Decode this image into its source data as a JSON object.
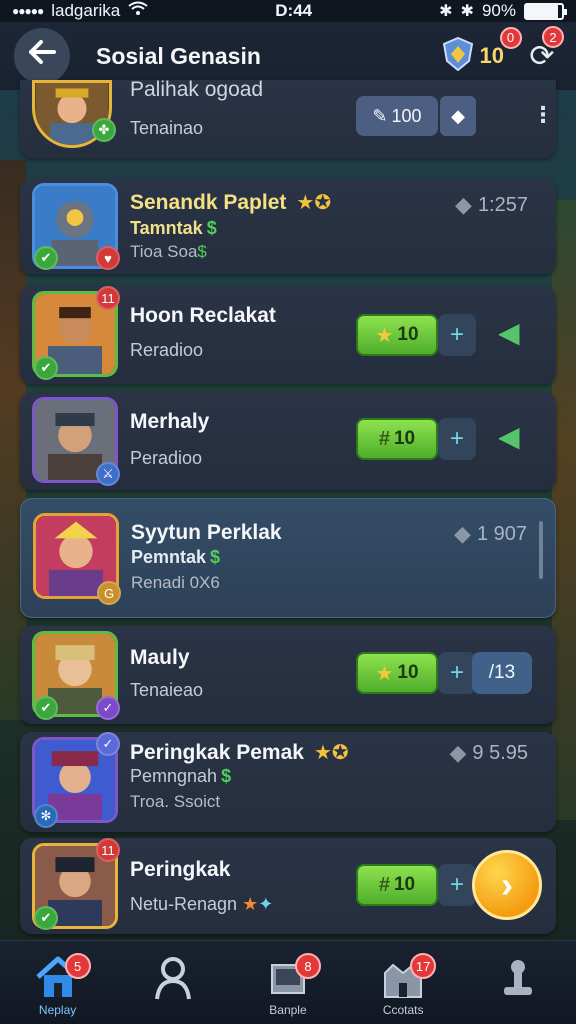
{
  "status_bar": {
    "carrier": "ladgarika",
    "time": "D:44",
    "battery": "90%",
    "battery_level": 0.9
  },
  "header": {
    "back_icon": "arrow-left-icon",
    "title": "Sosial Genasin",
    "gems": "10",
    "gem_badge": "0",
    "refresh_badge": "2"
  },
  "colors": {
    "accent_green": "#5cbd44",
    "badge_red": "#e3383a",
    "gold": "#f4c33c"
  },
  "rows": [
    {
      "name": "Palihak ogoad",
      "sub": "Tenainao",
      "button": "100",
      "button_icon": "pencil-icon"
    },
    {
      "name": "Senandk Paplet",
      "sub": "Tamntak",
      "sub3": "Tioa Soa",
      "score": "1:257"
    },
    {
      "name": "Hoon Reclakat",
      "sub": "Reradioo",
      "button": "10",
      "avatar_badge": "11"
    },
    {
      "name": "Merhaly",
      "sub": "Peradioo",
      "button": "10"
    },
    {
      "name": "Syytun Perklak",
      "sub": "Pemntak",
      "sub3": "Renadi 0X6",
      "score": "1 907"
    },
    {
      "name": "Mauly",
      "sub": "Tenaieao",
      "button": "10",
      "stat": "/13"
    },
    {
      "name": "Peringkak Pemak",
      "sub": "Pemngnah",
      "sub3": "Troa. Ssoict",
      "score": "9 5.95"
    },
    {
      "name": "Peringkak",
      "sub": "Netu-Renagn",
      "button": "10",
      "avatar_badge": "11"
    }
  ],
  "bottom_nav": [
    {
      "label": "Neplay",
      "badge": "5",
      "icon": "home-icon"
    },
    {
      "label": "",
      "badge": "",
      "icon": "profile-icon"
    },
    {
      "label": "Banple",
      "badge": "8",
      "icon": "box-icon"
    },
    {
      "label": "Ccotats",
      "badge": "17",
      "icon": "castle-icon"
    },
    {
      "label": "",
      "badge": "",
      "icon": "leaderboard-icon"
    }
  ]
}
